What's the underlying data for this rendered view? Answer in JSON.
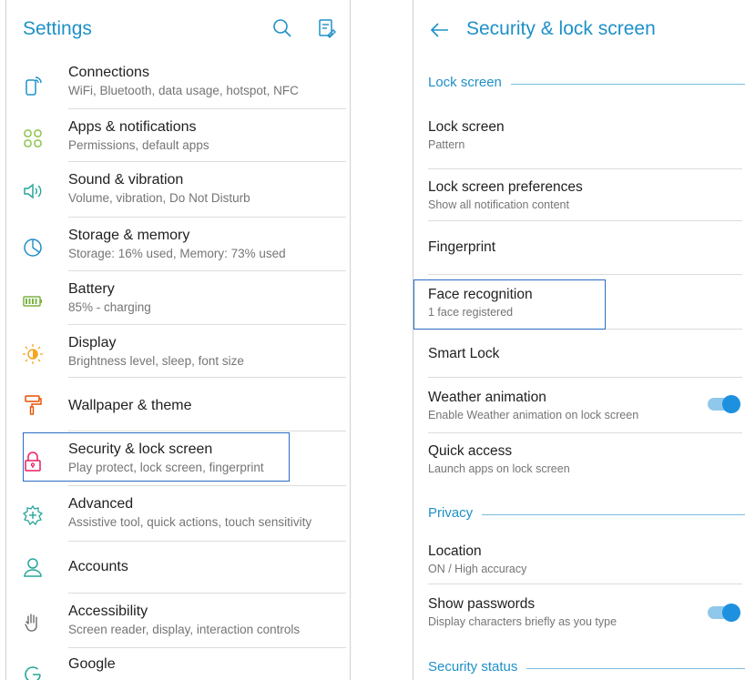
{
  "left": {
    "title": "Settings",
    "toolbar": {
      "search_icon": "search-icon",
      "edit_icon": "clipboard-edit-icon"
    },
    "items": [
      {
        "id": "connections",
        "label": "Connections",
        "sub": "WiFi, Bluetooth, data usage, hotspot, NFC",
        "icon": "phone-signal-icon",
        "color": "#1e90c8"
      },
      {
        "id": "apps",
        "label": "Apps & notifications",
        "sub": "Permissions, default apps",
        "icon": "apps-grid-icon",
        "color": "#8bc34a"
      },
      {
        "id": "sound",
        "label": "Sound & vibration",
        "sub": "Volume, vibration, Do Not Disturb",
        "icon": "speaker-icon",
        "color": "#26a69a"
      },
      {
        "id": "storage",
        "label": "Storage & memory",
        "sub": "Storage: 16% used, Memory: 73% used",
        "icon": "pie-chart-icon",
        "color": "#1e90c8"
      },
      {
        "id": "battery",
        "label": "Battery",
        "sub": "85% - charging",
        "icon": "battery-icon",
        "color": "#7cb342"
      },
      {
        "id": "display",
        "label": "Display",
        "sub": "Brightness level, sleep, font size",
        "icon": "brightness-icon",
        "color": "#f5a623"
      },
      {
        "id": "wallpaper",
        "label": "Wallpaper & theme",
        "sub": "",
        "icon": "paint-roller-icon",
        "color": "#e65100"
      },
      {
        "id": "security",
        "label": "Security & lock screen",
        "sub": "Play protect, lock screen, fingerprint",
        "icon": "lock-icon",
        "color": "#e91e63"
      },
      {
        "id": "advanced",
        "label": "Advanced",
        "sub": "Assistive tool, quick actions, touch sensitivity",
        "icon": "gear-plus-icon",
        "color": "#26a69a"
      },
      {
        "id": "accounts",
        "label": "Accounts",
        "sub": "",
        "icon": "person-icon",
        "color": "#26a69a"
      },
      {
        "id": "accessibility",
        "label": "Accessibility",
        "sub": "Screen reader, display, interaction controls",
        "icon": "hand-icon",
        "color": "#616161"
      },
      {
        "id": "google",
        "label": "Google",
        "sub": "",
        "icon": "google-icon",
        "color": "#26a69a"
      }
    ]
  },
  "right": {
    "title": "Security & lock screen",
    "back_icon": "back-arrow-icon",
    "sections": {
      "lock_screen": "Lock screen",
      "privacy": "Privacy",
      "security_status": "Security status"
    },
    "items": {
      "lock_screen": {
        "label": "Lock screen",
        "sub": "Pattern"
      },
      "lock_prefs": {
        "label": "Lock screen preferences",
        "sub": "Show all notification content"
      },
      "fingerprint": {
        "label": "Fingerprint",
        "sub": ""
      },
      "face": {
        "label": "Face recognition",
        "sub": "1 face registered"
      },
      "smart_lock": {
        "label": "Smart Lock",
        "sub": ""
      },
      "weather": {
        "label": "Weather animation",
        "sub": "Enable Weather animation on lock screen",
        "toggle_on": true
      },
      "quick_access": {
        "label": "Quick access",
        "sub": "Launch apps on lock screen"
      },
      "location": {
        "label": "Location",
        "sub": "ON / High accuracy"
      },
      "show_passwords": {
        "label": "Show passwords",
        "sub": "Display characters briefly as you type",
        "toggle_on": true
      }
    }
  },
  "colors": {
    "accent": "#1e90c8",
    "highlight_box": "#2a6cc4",
    "toggle_on": "#1e90e0"
  }
}
